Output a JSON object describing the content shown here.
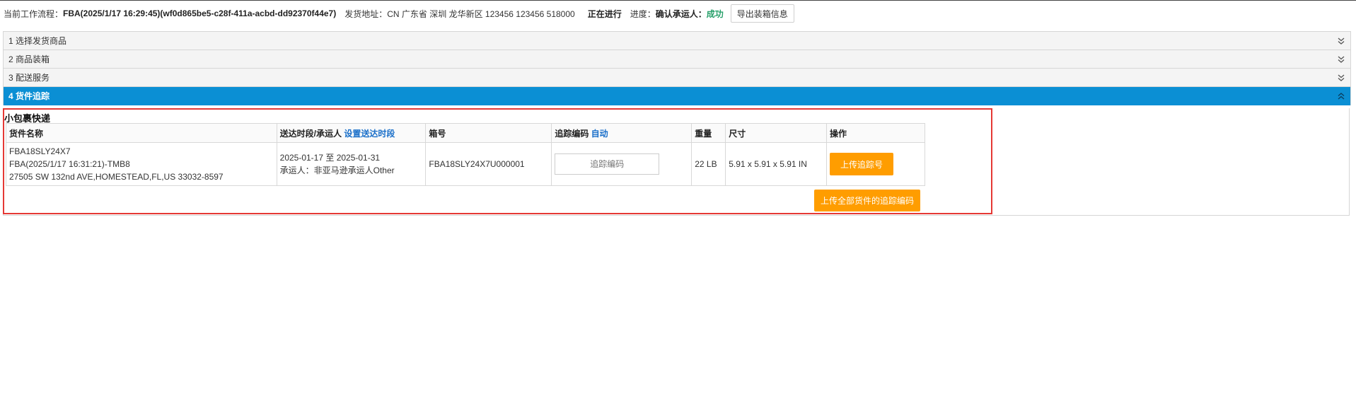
{
  "header": {
    "workflow_label": "当前工作流程：",
    "workflow_value": "FBA(2025/1/17 16:29:45)(wf0d865be5-c28f-411a-acbd-dd92370f44e7)",
    "address_label": "发货地址：",
    "address_value": "CN 广东省 深圳 龙华新区 123456 123456 518000",
    "status": "正在进行",
    "progress_label": "进度：",
    "progress_step": "确认承运人：",
    "progress_result": "成功",
    "export_button": "导出装箱信息"
  },
  "accordion": [
    {
      "label": "1 选择发货商品",
      "state": "collapsed"
    },
    {
      "label": "2 商品装箱",
      "state": "collapsed"
    },
    {
      "label": "3 配送服务",
      "state": "collapsed"
    },
    {
      "label": "4 货件追踪",
      "state": "expanded"
    }
  ],
  "section": {
    "title": "小包裹快递",
    "columns": {
      "name": "货件名称",
      "delivery": "送达时段/承运人",
      "delivery_link": "设置送达时段",
      "box": "箱号",
      "tracking": "追踪编码",
      "tracking_link": "自动",
      "weight": "重量",
      "size": "尺寸",
      "action": "操作"
    },
    "rows": [
      {
        "name_line1": "FBA18SLY24X7",
        "name_line2": "FBA(2025/1/17 16:31:21)-TMB8",
        "name_line3": "27505 SW 132nd AVE,HOMESTEAD,FL,US 33032-8597",
        "delivery_line1": "2025-01-17 至 2025-01-31",
        "delivery_line2": "承运人：非亚马逊承运人Other",
        "box": "FBA18SLY24X7U000001",
        "tracking_placeholder": "追踪编码",
        "weight": "22 LB",
        "size": "5.91 x 5.91 x 5.91 IN",
        "action_button": "上传追踪号"
      }
    ],
    "upload_all_button": "上传全部货件的追踪编码"
  },
  "colors": {
    "accent": "#0b8fd4",
    "button": "#ff9d00",
    "success": "#27a06a",
    "highlight_border": "#e53935"
  }
}
